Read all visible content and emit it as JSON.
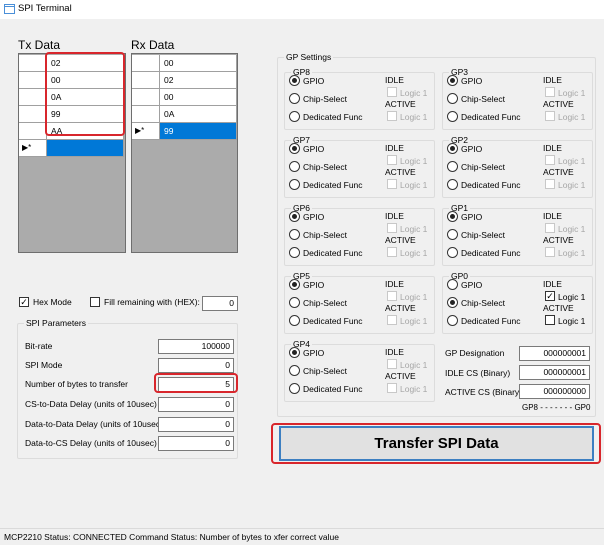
{
  "window": {
    "title": "SPI Terminal"
  },
  "tx": {
    "label": "Tx Data",
    "rows": [
      "02",
      "00",
      "0A",
      "99",
      "AA"
    ],
    "new_row_marker": "▶*"
  },
  "rx": {
    "label": "Rx Data",
    "rows": [
      "00",
      "02",
      "00",
      "0A",
      "99"
    ],
    "new_row_marker": "▶*"
  },
  "options": {
    "hex_mode": "Hex Mode",
    "hex_mode_checked": true,
    "fill_label": "Fill remaining with (HEX):",
    "fill_value": "0"
  },
  "spi": {
    "title": "SPI Parameters",
    "params": [
      {
        "label": "Bit-rate",
        "value": "100000"
      },
      {
        "label": "SPI Mode",
        "value": "0"
      },
      {
        "label": "Number of bytes to transfer",
        "value": "5"
      },
      {
        "label": "CS-to-Data Delay (units of 10usec)",
        "value": "0"
      },
      {
        "label": "Data-to-Data Delay (units of 10usec)",
        "value": "0"
      },
      {
        "label": "Data-to-CS Delay (units of 10usec)",
        "value": "0"
      }
    ]
  },
  "gp": {
    "title": "GP Settings",
    "gpio": "GPIO",
    "cs": "Chip-Select",
    "ded": "Dedicated Func",
    "idle": "IDLE",
    "active": "ACTIVE",
    "logic": "Logic 1",
    "groups": [
      {
        "name": "GP8",
        "sel": "gpio",
        "idle_checked": false,
        "active_checked": false
      },
      {
        "name": "GP3",
        "sel": "gpio",
        "idle_checked": false,
        "active_checked": false
      },
      {
        "name": "GP7",
        "sel": "gpio",
        "idle_checked": false,
        "active_checked": false
      },
      {
        "name": "GP2",
        "sel": "gpio",
        "idle_checked": false,
        "active_checked": false
      },
      {
        "name": "GP6",
        "sel": "gpio",
        "idle_checked": false,
        "active_checked": false
      },
      {
        "name": "GP1",
        "sel": "gpio",
        "idle_checked": false,
        "active_checked": false
      },
      {
        "name": "GP5",
        "sel": "gpio",
        "idle_checked": false,
        "active_checked": false
      },
      {
        "name": "GP0",
        "sel": "cs",
        "idle_checked": true,
        "active_checked": false
      },
      {
        "name": "GP4",
        "sel": "gpio",
        "idle_checked": false,
        "active_checked": false
      }
    ],
    "designation_label": "GP Designation",
    "designation": "000000001",
    "idle_cs_label": "IDLE CS (Binary)",
    "idle_cs": "000000001",
    "active_cs_label": "ACTIVE CS (Binary)",
    "active_cs": "000000000",
    "range": "GP8 - - - - - - - GP0"
  },
  "transfer": {
    "label": "Transfer SPI Data"
  },
  "status": {
    "text": "MCP2210 Status: CONNECTED   Command Status: Number of bytes to xfer correct value"
  }
}
